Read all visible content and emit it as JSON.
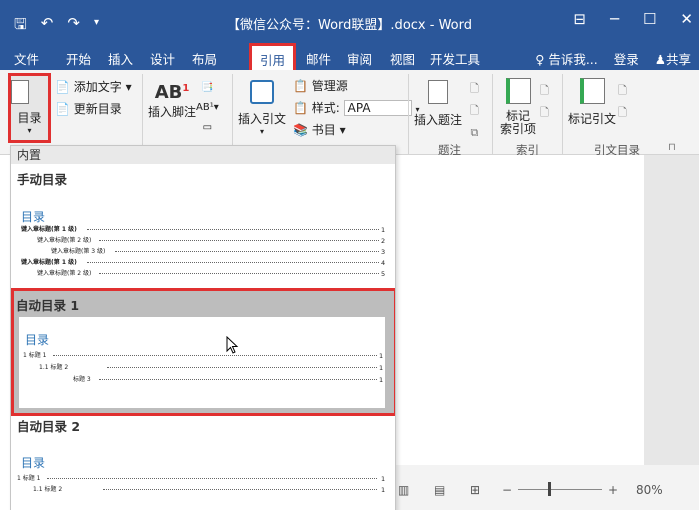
{
  "window": {
    "title": "【微信公众号：Word联盟】.docx - Word",
    "quick_access": [
      "save-icon",
      "undo-icon",
      "redo-icon",
      "customize-icon"
    ]
  },
  "menu": {
    "tabs": [
      "文件",
      "开始",
      "插入",
      "设计",
      "布局",
      "引用",
      "邮件",
      "审阅",
      "视图",
      "开发工具"
    ],
    "active_tab": "引用",
    "tell_me": "告诉我...",
    "login": "登录",
    "share": "共享"
  },
  "ribbon": {
    "toc": {
      "label": "目录",
      "add_text": "添加文字",
      "update": "更新目录"
    },
    "footnote": {
      "insert": "插入脚注",
      "ab_label": "AB",
      "sup": "1"
    },
    "citation": {
      "insert": "插入引文",
      "manage": "管理源",
      "style_label": "样式:",
      "style_value": "APA",
      "bib": "书目"
    },
    "caption": {
      "insert": "插入题注",
      "group": "题注"
    },
    "index": {
      "mark": "标记",
      "mark2": "索引项",
      "group": "索引"
    },
    "toa": {
      "mark": "标记引文",
      "group": "引文目录"
    }
  },
  "dropdown": {
    "builtin": "内置",
    "manual": {
      "title": "手动目录",
      "heading": "目录",
      "lines": [
        {
          "text": "键入章标题(第 1 级)",
          "num": "1"
        },
        {
          "text": "键入章标题(第 2 级)",
          "num": "2"
        },
        {
          "text": "键入章标题(第 3 级)",
          "num": "3"
        },
        {
          "text": "键入章标题(第 1 级)",
          "num": "4"
        },
        {
          "text": "键入章标题(第 2 级)",
          "num": "5"
        }
      ]
    },
    "auto1": {
      "title": "自动目录 1",
      "heading": "目录",
      "lines": [
        {
          "text": "1 标题 1",
          "num": "1"
        },
        {
          "text": "1.1 标题 2",
          "num": "1"
        },
        {
          "text": "标题 3",
          "num": "1"
        }
      ]
    },
    "auto2": {
      "title": "自动目录 2",
      "heading": "目录",
      "lines": [
        {
          "text": "1 标题 1",
          "num": "1"
        },
        {
          "text": "1.1 标题 2",
          "num": "1"
        }
      ]
    }
  },
  "status": {
    "zoom": "80%"
  }
}
